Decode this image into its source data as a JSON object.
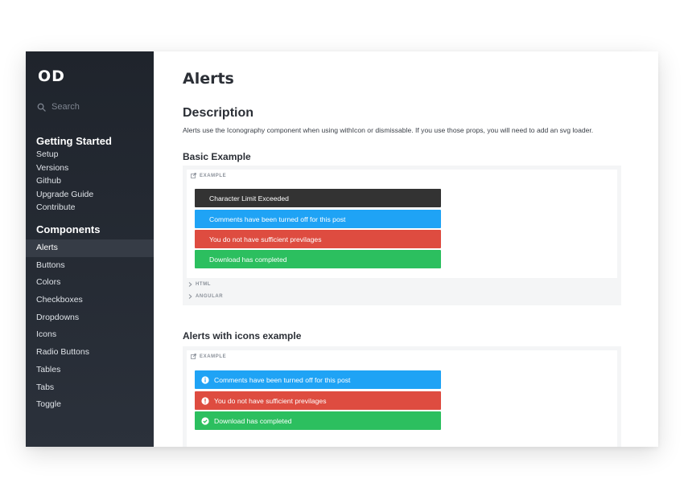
{
  "sidebar": {
    "logo": "OD",
    "search_placeholder": "Search",
    "getting_started": {
      "title": "Getting Started",
      "items": [
        "Setup",
        "Versions",
        "Github",
        "Upgrade Guide",
        "Contribute"
      ]
    },
    "components": {
      "title": "Components",
      "items": [
        "Alerts",
        "Buttons",
        "Colors",
        "Checkboxes",
        "Dropdowns",
        "Icons",
        "Radio Buttons",
        "Tables",
        "Tabs",
        "Toggle"
      ],
      "active": "Alerts"
    }
  },
  "main": {
    "title": "Alerts",
    "description_heading": "Description",
    "description_text": "Alerts use the Iconography component when using withIcon or dismissable. If you use those props, you will need to add an svg loader.",
    "basic": {
      "heading": "Basic Example",
      "example_label": "EXAMPLE",
      "alerts": [
        "Character Limit Exceeded",
        "Comments have been turned off for this post",
        "You do not have sufficient previlages",
        "Download has completed"
      ],
      "code_tabs": [
        "HTML",
        "ANGULAR"
      ]
    },
    "icons": {
      "heading": "Alerts with icons example",
      "example_label": "EXAMPLE",
      "alerts": [
        "Comments have been turned off for this post",
        "You do not have sufficient previlages",
        "Download has completed"
      ],
      "icon_names": [
        "info-icon",
        "error-icon",
        "check-circle-icon"
      ]
    }
  },
  "colors": {
    "sidebar_bg": "#1f242c",
    "active_item_bg": "#363c46",
    "alert_dark": "#333333",
    "alert_info": "#1fa3f5",
    "alert_error": "#de4c40",
    "alert_success": "#2cbf5f"
  }
}
